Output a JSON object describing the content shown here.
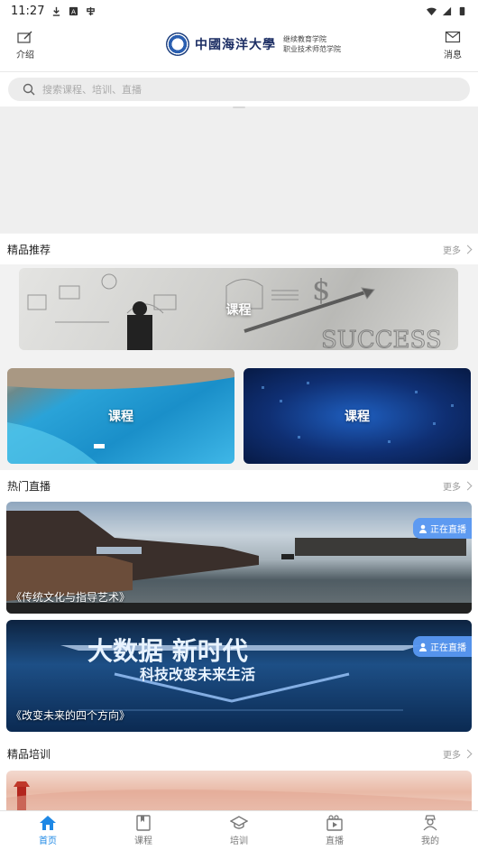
{
  "status_bar": {
    "time": "11:27"
  },
  "header": {
    "intro_label": "介绍",
    "message_label": "消息",
    "logo_name": "中國海洋大學",
    "logo_sub_line1": "继续教育学院",
    "logo_sub_line2": "职业技术师范学院"
  },
  "search": {
    "placeholder": "搜索课程、培训、直播"
  },
  "recommended": {
    "title": "精品推荐",
    "more": "更多",
    "cards": [
      {
        "label": "课程"
      },
      {
        "label": "课程"
      },
      {
        "label": "课程"
      }
    ]
  },
  "live": {
    "title": "热门直播",
    "more": "更多",
    "items": [
      {
        "title": "《传统文化与指导艺术》",
        "badge": "正在直播"
      },
      {
        "title": "《改变未来的四个方向》",
        "badge": "正在直播",
        "banner_text1": "大数据 新时代",
        "banner_text2": "科技改变未来生活"
      }
    ]
  },
  "training": {
    "title": "精品培训",
    "more": "更多"
  },
  "tabbar": {
    "items": [
      {
        "label": "首页",
        "icon": "home-icon"
      },
      {
        "label": "课程",
        "icon": "book-icon"
      },
      {
        "label": "培训",
        "icon": "graduation-cap-icon"
      },
      {
        "label": "直播",
        "icon": "live-tv-icon"
      },
      {
        "label": "我的",
        "icon": "profile-icon"
      }
    ],
    "active_color": "#1e88e5"
  }
}
